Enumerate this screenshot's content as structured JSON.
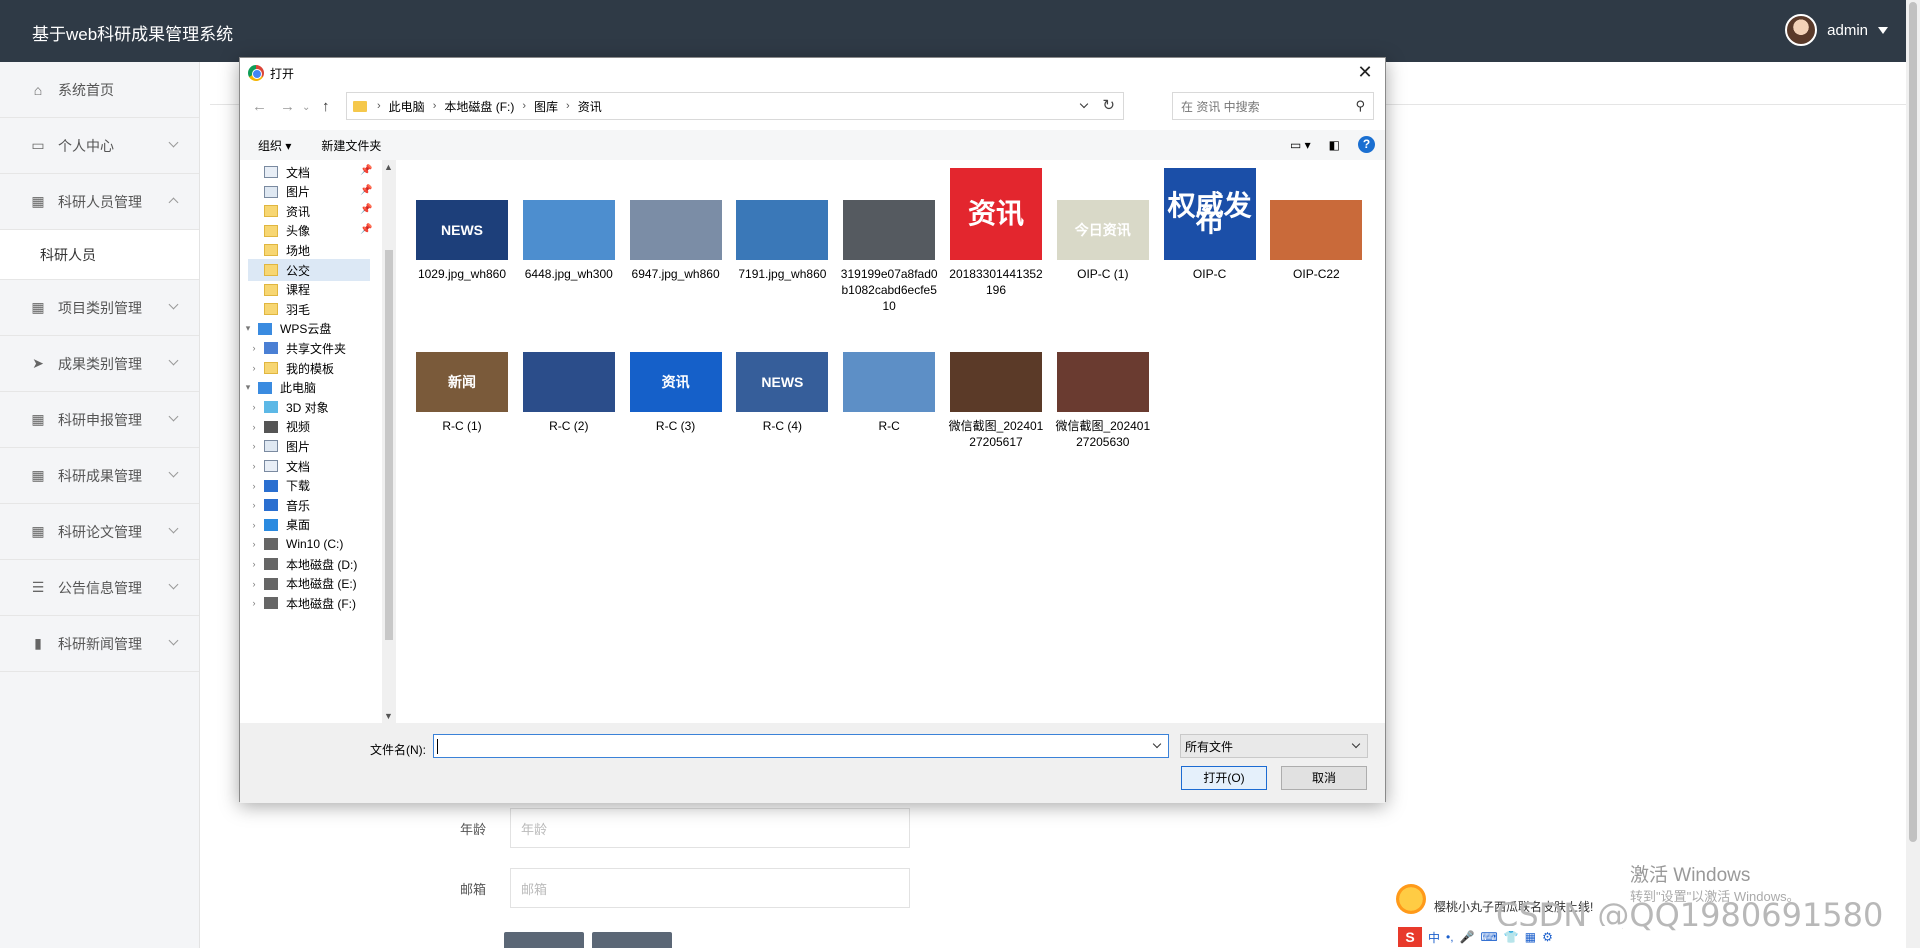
{
  "app": {
    "title": "基于web科研成果管理系统",
    "user": "admin"
  },
  "sidebar": {
    "items": [
      {
        "label": "系统首页",
        "icon": "home-icon",
        "glyph": "⌂",
        "chev": ""
      },
      {
        "label": "个人中心",
        "icon": "card-icon",
        "glyph": "▭",
        "chev": "down"
      },
      {
        "label": "科研人员管理",
        "icon": "grid-icon",
        "glyph": "▦",
        "chev": "up"
      },
      {
        "label": "项目类别管理",
        "icon": "grid-icon",
        "glyph": "▦",
        "chev": "down"
      },
      {
        "label": "成果类别管理",
        "icon": "send-icon",
        "glyph": "➤",
        "chev": "down"
      },
      {
        "label": "科研申报管理",
        "icon": "grid-icon",
        "glyph": "▦",
        "chev": "down"
      },
      {
        "label": "科研成果管理",
        "icon": "grid-icon",
        "glyph": "▦",
        "chev": "down"
      },
      {
        "label": "科研论文管理",
        "icon": "grid-icon",
        "glyph": "▦",
        "chev": "down"
      },
      {
        "label": "公告信息管理",
        "icon": "sliders-icon",
        "glyph": "☰",
        "chev": "down"
      },
      {
        "label": "科研新闻管理",
        "icon": "bar-chart-icon",
        "glyph": "▮",
        "chev": "down"
      }
    ],
    "submenu": "科研人员"
  },
  "form": {
    "age_label": "年龄",
    "age_placeholder": "年龄",
    "email_label": "邮箱",
    "email_placeholder": "邮箱"
  },
  "dialog": {
    "title": "打开",
    "breadcrumb": [
      "此电脑",
      "本地磁盘 (F:)",
      "图库",
      "资讯"
    ],
    "search_placeholder": "在 资讯 中搜索",
    "toolbar": {
      "organize": "组织 ▾",
      "new_folder": "新建文件夹"
    },
    "tree": [
      {
        "label": "文档",
        "type": "doc",
        "indent": 1,
        "pinned": true
      },
      {
        "label": "图片",
        "type": "pic",
        "indent": 1,
        "pinned": true
      },
      {
        "label": "资讯",
        "type": "folder",
        "indent": 1,
        "pinned": true
      },
      {
        "label": "头像",
        "type": "folder",
        "indent": 1,
        "pinned": true
      },
      {
        "label": "场地",
        "type": "folder",
        "indent": 1,
        "pinned": false
      },
      {
        "label": "公交",
        "type": "folder",
        "indent": 1,
        "pinned": false,
        "selected": true
      },
      {
        "label": "课程",
        "type": "folder",
        "indent": 1,
        "pinned": false
      },
      {
        "label": "羽毛",
        "type": "folder",
        "indent": 1,
        "pinned": false
      },
      {
        "label": "WPS云盘",
        "type": "cloud",
        "indent": 0,
        "expanded": true
      },
      {
        "label": "共享文件夹",
        "type": "share",
        "indent": 1,
        "collapsed": true
      },
      {
        "label": "我的模板",
        "type": "folder",
        "indent": 1,
        "collapsed": true
      },
      {
        "label": "此电脑",
        "type": "pc",
        "indent": 0,
        "expanded": true
      },
      {
        "label": "3D 对象",
        "type": "3d",
        "indent": 1,
        "collapsed": true
      },
      {
        "label": "视频",
        "type": "video",
        "indent": 1,
        "collapsed": true
      },
      {
        "label": "图片",
        "type": "pic",
        "indent": 1,
        "collapsed": true
      },
      {
        "label": "文档",
        "type": "doc",
        "indent": 1,
        "collapsed": true
      },
      {
        "label": "下载",
        "type": "download",
        "indent": 1,
        "collapsed": true
      },
      {
        "label": "音乐",
        "type": "music",
        "indent": 1,
        "collapsed": true
      },
      {
        "label": "桌面",
        "type": "desktop",
        "indent": 1,
        "collapsed": true
      },
      {
        "label": "Win10 (C:)",
        "type": "drive",
        "indent": 1,
        "collapsed": true
      },
      {
        "label": "本地磁盘 (D:)",
        "type": "drive",
        "indent": 1,
        "collapsed": true
      },
      {
        "label": "本地磁盘 (E:)",
        "type": "drive",
        "indent": 1,
        "collapsed": true
      },
      {
        "label": "本地磁盘 (F:)",
        "type": "drive",
        "indent": 1,
        "collapsed": true
      }
    ],
    "files": [
      {
        "name": "1029.jpg_wh860",
        "thumb": "NEWS",
        "bg": "#1d3f7a"
      },
      {
        "name": "6448.jpg_wh300",
        "thumb": "",
        "bg": "#4d8ecf"
      },
      {
        "name": "6947.jpg_wh860",
        "thumb": "",
        "bg": "#7b8da6"
      },
      {
        "name": "7191.jpg_wh860",
        "thumb": "",
        "bg": "#3a78b8"
      },
      {
        "name": "319199e07a8fad0b1082cabd6ecfe510",
        "thumb": "",
        "bg": "#555a60"
      },
      {
        "name": "20183301441352196",
        "thumb": "资讯",
        "bg": "#e3262e",
        "big": true
      },
      {
        "name": "OIP-C (1)",
        "thumb": "今日资讯",
        "bg": "#d9d9c8"
      },
      {
        "name": "OIP-C",
        "thumb": "权威发布",
        "bg": "#1b4fa8",
        "big": true
      },
      {
        "name": "OIP-C22",
        "thumb": "",
        "bg": "#c96a3a"
      },
      {
        "name": "R-C (1)",
        "thumb": "新闻",
        "bg": "#7a5a3a"
      },
      {
        "name": "R-C (2)",
        "thumb": "",
        "bg": "#2b4d8a"
      },
      {
        "name": "R-C (3)",
        "thumb": "资讯",
        "bg": "#1560c9"
      },
      {
        "name": "R-C (4)",
        "thumb": "NEWS",
        "bg": "#365e9a"
      },
      {
        "name": "R-C",
        "thumb": "",
        "bg": "#5d8fc6"
      },
      {
        "name": "微信截图_20240127205617",
        "thumb": "",
        "bg": "#5b3a28"
      },
      {
        "name": "微信截图_20240127205630",
        "thumb": "",
        "bg": "#6a3b30"
      }
    ],
    "filename_label": "文件名(N):",
    "filename_value": "",
    "filter": "所有文件",
    "open_label": "打开(O)",
    "cancel_label": "取消"
  },
  "overlay": {
    "activate_title": "激活 Windows",
    "activate_sub": "转到\"设置\"以激活 Windows。",
    "watermark": "CSDN @QQ1980691580",
    "ime_notice": "樱桃小丸子西瓜联名皮肤上线!",
    "ime_glyph": "S",
    "ime_mode": "中"
  }
}
